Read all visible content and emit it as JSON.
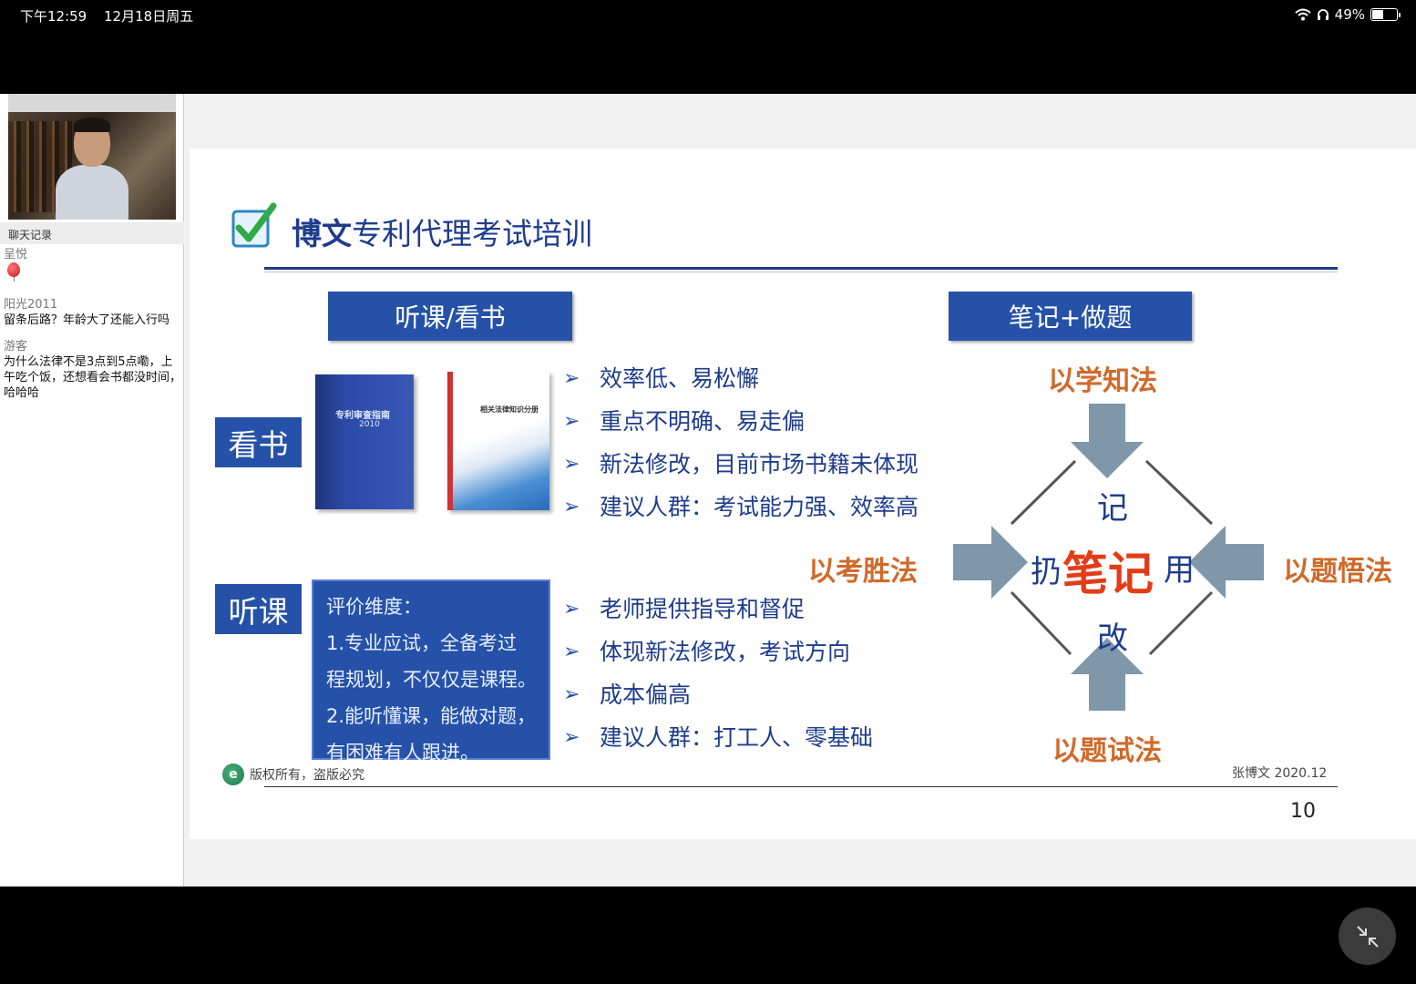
{
  "status_bar": {
    "time": "下午12:59",
    "date": "12月18日周五",
    "battery": "49%",
    "battery_fraction": 0.49
  },
  "chat": {
    "header": "聊天记录",
    "messages": [
      {
        "user": "呈悦",
        "text": ""
      },
      {
        "user": "阳光2011",
        "text": "留条后路？年龄大了还能入行吗"
      },
      {
        "user": "游客",
        "text": "为什么法律不是3点到5点嘞，上午吃个饭，还想看会书都没时间，哈哈哈"
      }
    ]
  },
  "slide": {
    "title_bold": "博文",
    "title_rest": "专利代理考试培训",
    "left_header": "听课/看书",
    "right_header": "笔记+做题",
    "tag_read": "看书",
    "tag_listen": "听课",
    "book1_title": "专利审查指南",
    "book1_year": "2010",
    "book2_title": "相关法律知识分册",
    "read_bullets": [
      "效率低、易松懈",
      "重点不明确、易走偏",
      "新法修改，目前市场书籍未体现",
      "建议人群：考试能力强、效率高"
    ],
    "listen_bullets": [
      "老师提供指导和督促",
      "体现新法修改，考试方向",
      "成本偏高",
      "建议人群：打工人、零基础"
    ],
    "eval_lines": [
      "评价维度：",
      "1.专业应试，全备考过",
      "程规划，不仅仅是课程。",
      "2.能听懂课，能做对题，",
      "有困难有人跟进。"
    ],
    "diagram": {
      "top": "以学知法",
      "bottom": "以题试法",
      "left": "以考胜法",
      "right": "以题悟法",
      "center": "笔记",
      "n": "记",
      "w": "扔",
      "e": "用",
      "s": "改",
      "arrow_color": "#7f97a8",
      "label_color": "#d06a2a",
      "center_color": "#e23d18"
    },
    "footer_left": "版权所有，盗版必究",
    "footer_right": "张博文 2020.12",
    "page_number": "10"
  },
  "colors": {
    "brand_blue": "#2552a8",
    "title_blue": "#1e3c8c"
  }
}
